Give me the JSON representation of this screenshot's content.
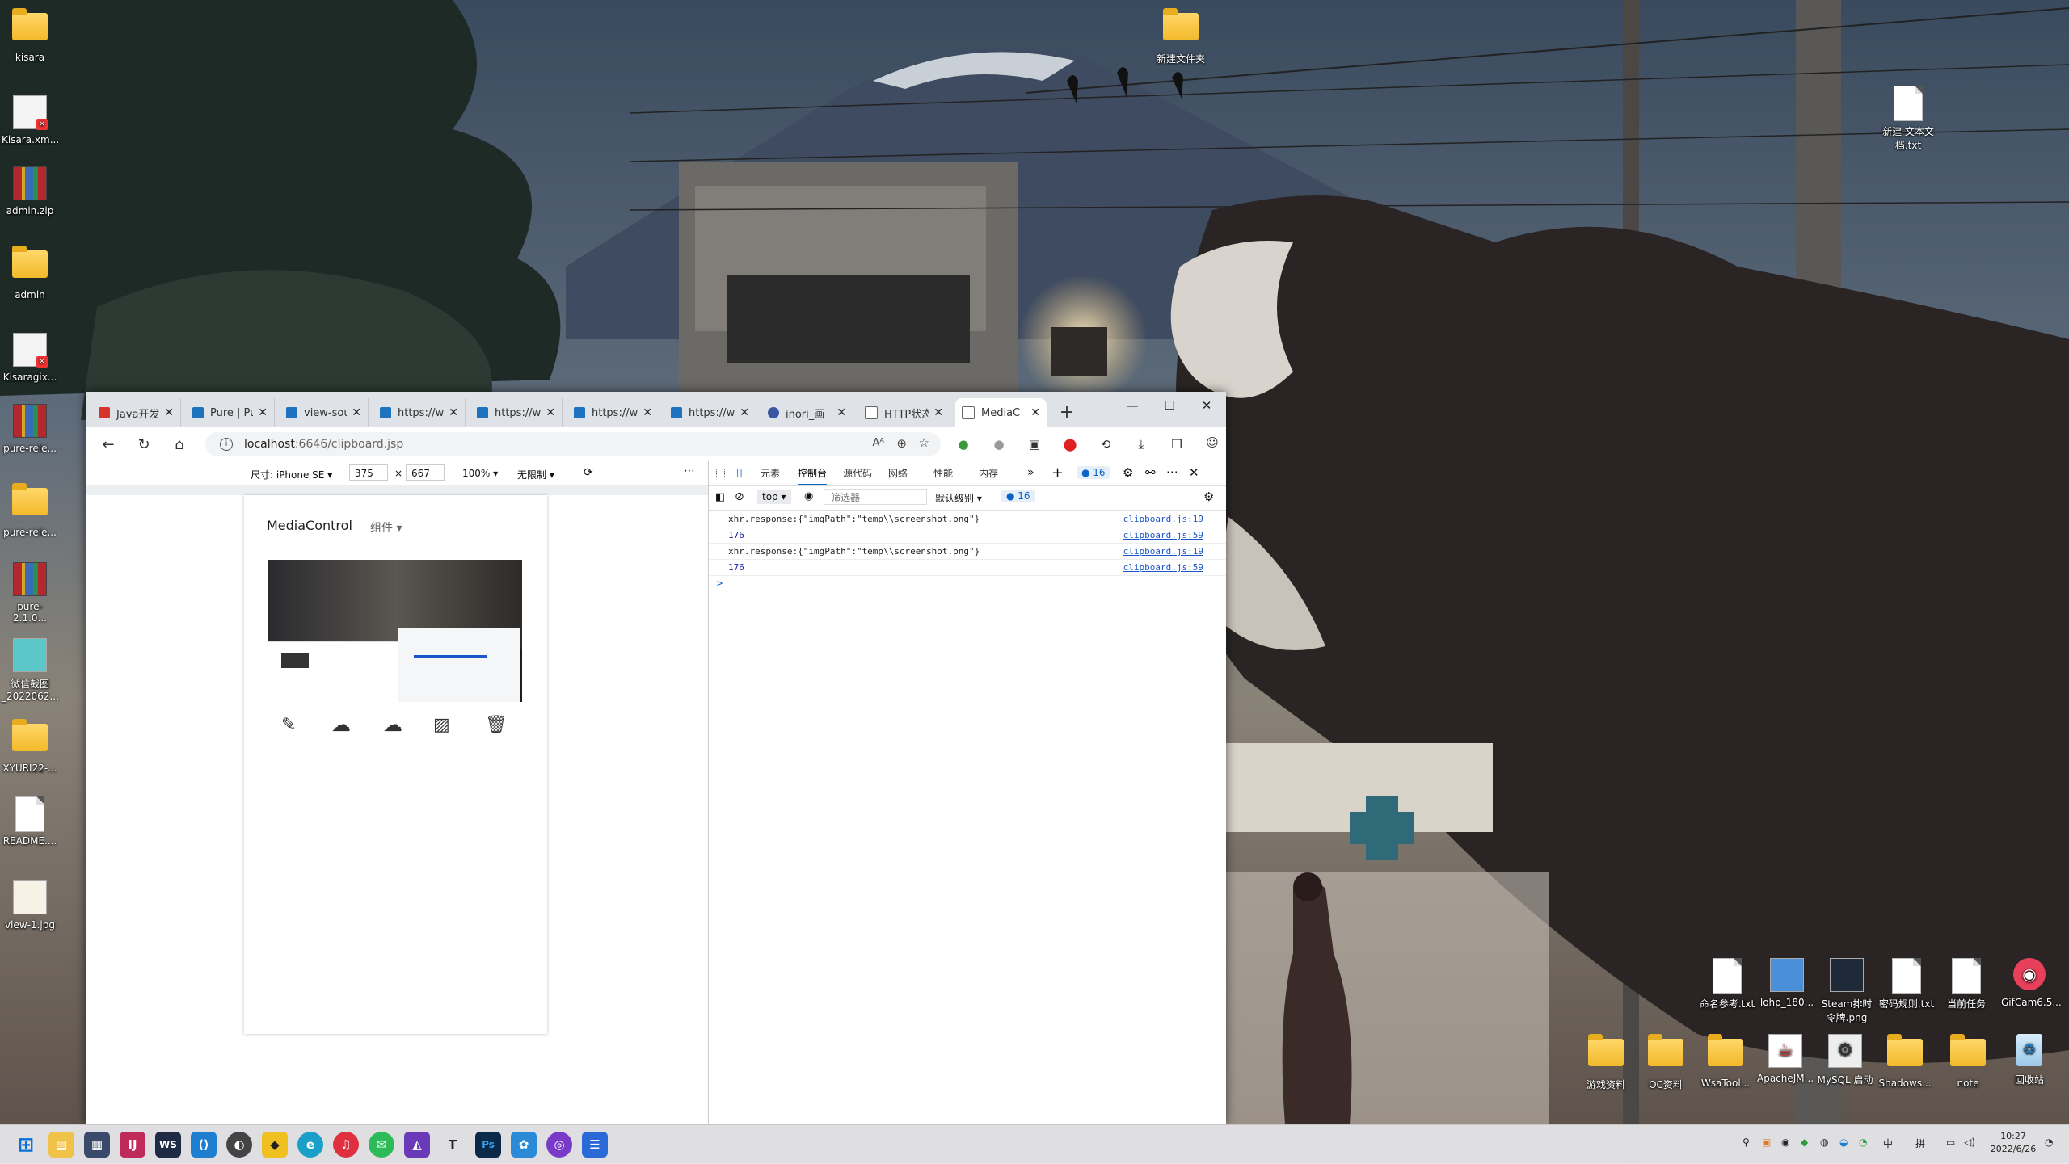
{
  "desktop": {
    "left_icons": [
      {
        "label": "kisara",
        "type": "folder"
      },
      {
        "label": "Kisara.xm...",
        "type": "image-doc"
      },
      {
        "label": "admin.zip",
        "type": "archive"
      },
      {
        "label": "admin",
        "type": "folder"
      },
      {
        "label": "Kisaragix...",
        "type": "image-doc"
      },
      {
        "label": "pure-rele...",
        "type": "archive"
      },
      {
        "label": "pure-rele...",
        "type": "folder"
      },
      {
        "label": "pure-2.1.0...",
        "type": "archive"
      },
      {
        "label": "微信截图_2022062...",
        "type": "image"
      },
      {
        "label": "XYURI22-...",
        "type": "folder"
      },
      {
        "label": "README....",
        "type": "doc"
      },
      {
        "label": "view-1.jpg",
        "type": "image"
      }
    ],
    "top_folder": "新建文件夹",
    "top_right_doc": "新建 文本文档.txt",
    "right_row1": [
      {
        "label": "命名参考.txt"
      },
      {
        "label": "lohp_180..."
      },
      {
        "label": "Steam排时令牌.png"
      },
      {
        "label": "密码规则.txt"
      },
      {
        "label": "当前任务"
      },
      {
        "label": "GifCam6.5..."
      }
    ],
    "right_row2": [
      {
        "label": "游戏资料"
      },
      {
        "label": "OC资料"
      },
      {
        "label": "WsaTool..."
      },
      {
        "label": "ApacheJM..."
      },
      {
        "label": "MySQL 启动"
      },
      {
        "label": "Shadows..."
      },
      {
        "label": "note"
      },
      {
        "label": "回收站"
      }
    ]
  },
  "browser": {
    "tabs": [
      {
        "label": "Java开发手",
        "fav_color": "#d9342b"
      },
      {
        "label": "Pure | Pur",
        "fav_color": "#1e73be"
      },
      {
        "label": "view-sour",
        "fav_color": "#1e73be"
      },
      {
        "label": "https://w",
        "fav_color": "#1e73be"
      },
      {
        "label": "https://w",
        "fav_color": "#1e73be"
      },
      {
        "label": "https://w",
        "fav_color": "#1e73be"
      },
      {
        "label": "https://w",
        "fav_color": "#1e73be"
      },
      {
        "label": "inori_画",
        "fav_color": "#3b55a3"
      },
      {
        "label": "HTTP状态",
        "fav_color": "#666666"
      },
      {
        "label": "MediaC",
        "fav_color": "#666666"
      }
    ],
    "address": {
      "host": "localhost",
      "path": ":6646/clipboard.jsp"
    },
    "device_toolbar": {
      "size_label": "尺寸: iPhone SE",
      "width": "375",
      "height": "667",
      "zoom": "100%",
      "throttle": "无限制"
    },
    "page": {
      "title": "MediaControl",
      "menu": "组件"
    }
  },
  "devtools": {
    "tabs": [
      "元素",
      "控制台",
      "源代码",
      "网络",
      "性能",
      "内存"
    ],
    "active_tab": "控制台",
    "issues_count": "16",
    "context": "top",
    "filter_placeholder": "筛选器",
    "level": "默认级别",
    "messages_count": "16",
    "console": [
      {
        "text": "xhr.response:{\"imgPath\":\"temp\\\\screenshot.png\"}",
        "src": "clipboard.js:19"
      },
      {
        "text": "176",
        "src": "clipboard.js:59"
      },
      {
        "text": "xhr.response:{\"imgPath\":\"temp\\\\screenshot.png\"}",
        "src": "clipboard.js:19"
      },
      {
        "text": "176",
        "src": "clipboard.js:59"
      }
    ],
    "prompt": ">"
  },
  "taskbar": {
    "clock_time": "10:27",
    "clock_date": "2022/6/26",
    "lang1": "中",
    "lang2": "拼"
  }
}
